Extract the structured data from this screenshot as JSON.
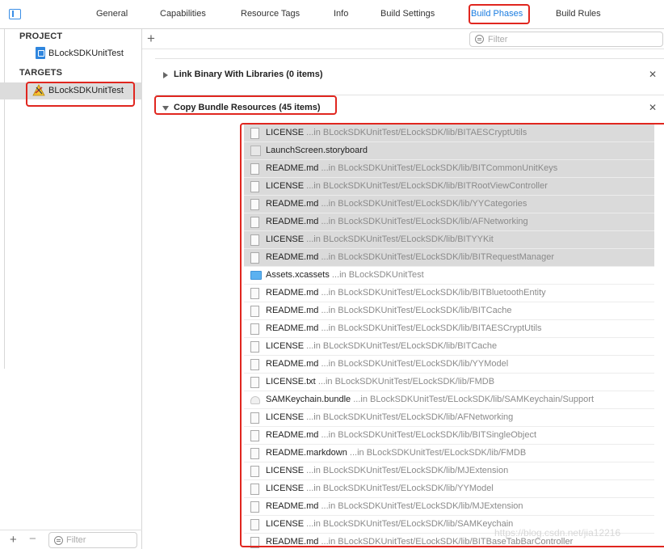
{
  "tabs": [
    {
      "label": "General"
    },
    {
      "label": "Capabilities"
    },
    {
      "label": "Resource Tags"
    },
    {
      "label": "Info"
    },
    {
      "label": "Build Settings"
    },
    {
      "label": "Build Phases",
      "active": true
    },
    {
      "label": "Build Rules"
    }
  ],
  "sidebar": {
    "project_header": "PROJECT",
    "project_item": "BLockSDKUnitTest",
    "targets_header": "TARGETS",
    "target_item": "BLockSDKUnitTest",
    "filter_placeholder": "Filter"
  },
  "main": {
    "filter_placeholder": "Filter",
    "phases": [
      {
        "title": "Link Binary With Libraries (0 items)",
        "expanded": false
      },
      {
        "title": "Copy Bundle Resources (45 items)",
        "expanded": true
      }
    ],
    "files": [
      {
        "name": "LICENSE",
        "path": "...in BLockSDKUnitTest/ELockSDK/lib/BITAESCryptUtils",
        "icon": "file-icon",
        "selected": true
      },
      {
        "name": "LaunchScreen.storyboard",
        "path": "",
        "icon": "storyboard-icon",
        "selected": true
      },
      {
        "name": "README.md",
        "path": "...in BLockSDKUnitTest/ELockSDK/lib/BITCommonUnitKeys",
        "icon": "file-icon",
        "selected": true
      },
      {
        "name": "LICENSE",
        "path": "...in BLockSDKUnitTest/ELockSDK/lib/BITRootViewController",
        "icon": "file-icon",
        "selected": true
      },
      {
        "name": "README.md",
        "path": "...in BLockSDKUnitTest/ELockSDK/lib/YYCategories",
        "icon": "file-icon",
        "selected": true
      },
      {
        "name": "README.md",
        "path": "...in BLockSDKUnitTest/ELockSDK/lib/AFNetworking",
        "icon": "file-icon",
        "selected": true
      },
      {
        "name": "LICENSE",
        "path": "...in BLockSDKUnitTest/ELockSDK/lib/BITYYKit",
        "icon": "file-icon",
        "selected": true
      },
      {
        "name": "README.md",
        "path": "...in BLockSDKUnitTest/ELockSDK/lib/BITRequestManager",
        "icon": "file-icon",
        "selected": true
      },
      {
        "name": "Assets.xcassets",
        "path": "...in BLockSDKUnitTest",
        "icon": "folder-icon",
        "selected": false
      },
      {
        "name": "README.md",
        "path": "...in BLockSDKUnitTest/ELockSDK/lib/BITBluetoothEntity",
        "icon": "file-icon",
        "selected": false
      },
      {
        "name": "README.md",
        "path": "...in BLockSDKUnitTest/ELockSDK/lib/BITCache",
        "icon": "file-icon",
        "selected": false
      },
      {
        "name": "README.md",
        "path": "...in BLockSDKUnitTest/ELockSDK/lib/BITAESCryptUtils",
        "icon": "file-icon",
        "selected": false
      },
      {
        "name": "LICENSE",
        "path": "...in BLockSDKUnitTest/ELockSDK/lib/BITCache",
        "icon": "file-icon",
        "selected": false
      },
      {
        "name": "README.md",
        "path": "...in BLockSDKUnitTest/ELockSDK/lib/YYModel",
        "icon": "file-icon",
        "selected": false
      },
      {
        "name": "LICENSE.txt",
        "path": "...in BLockSDKUnitTest/ELockSDK/lib/FMDB",
        "icon": "file-icon",
        "selected": false
      },
      {
        "name": "SAMKeychain.bundle",
        "path": "...in BLockSDKUnitTest/ELockSDK/lib/SAMKeychain/Support",
        "icon": "bundle-icon",
        "selected": false
      },
      {
        "name": "LICENSE",
        "path": "...in BLockSDKUnitTest/ELockSDK/lib/AFNetworking",
        "icon": "file-icon",
        "selected": false
      },
      {
        "name": "README.md",
        "path": "...in BLockSDKUnitTest/ELockSDK/lib/BITSingleObject",
        "icon": "file-icon",
        "selected": false
      },
      {
        "name": "README.markdown",
        "path": "...in BLockSDKUnitTest/ELockSDK/lib/FMDB",
        "icon": "file-icon",
        "selected": false
      },
      {
        "name": "LICENSE",
        "path": "...in BLockSDKUnitTest/ELockSDK/lib/MJExtension",
        "icon": "file-icon",
        "selected": false
      },
      {
        "name": "LICENSE",
        "path": "...in BLockSDKUnitTest/ELockSDK/lib/YYModel",
        "icon": "file-icon",
        "selected": false
      },
      {
        "name": "README.md",
        "path": "...in BLockSDKUnitTest/ELockSDK/lib/MJExtension",
        "icon": "file-icon",
        "selected": false
      },
      {
        "name": "LICENSE",
        "path": "...in BLockSDKUnitTest/ELockSDK/lib/SAMKeychain",
        "icon": "file-icon",
        "selected": false
      },
      {
        "name": "README.md",
        "path": "...in BLockSDKUnitTest/ELockSDK/lib/BITBaseTabBarController",
        "icon": "file-icon",
        "selected": false
      }
    ]
  },
  "watermark": "https://blog.csdn.net/jia12216",
  "colors": {
    "accent": "#1a7ce0",
    "highlight": "#e0261f",
    "selection": "#dadada"
  }
}
